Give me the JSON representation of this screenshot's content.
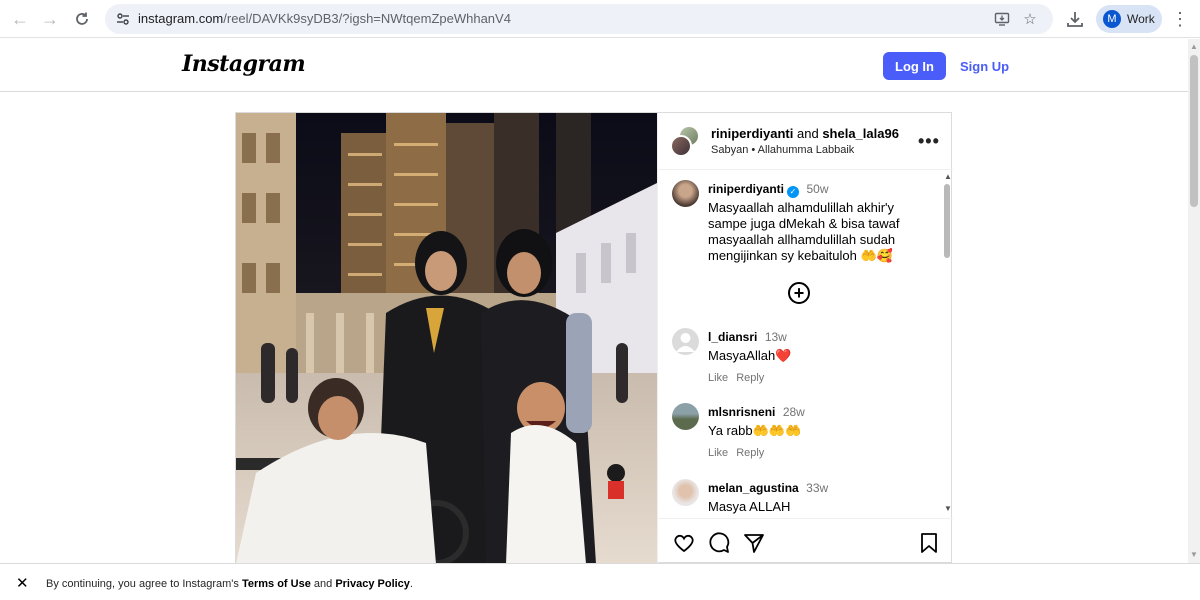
{
  "browser": {
    "url_host": "instagram.com",
    "url_path": "/reel/DAVKk9syDB3/?igsh=NWtqemZpeWhhanV4",
    "profile_initial": "M",
    "profile_label": "Work"
  },
  "header": {
    "logo": "Instagram",
    "login_label": "Log In",
    "signup_label": "Sign Up"
  },
  "post": {
    "user1": "riniperdiyanti",
    "and": "and",
    "user2": "shela_lala96",
    "audio": "Sabyan • Allahumma Labbaik",
    "more": "•••",
    "caption": {
      "user": "riniperdiyanti",
      "time": "50w",
      "text": "Masyaallah alhamdulillah akhir'y sampe juga dMekah & bisa tawaf masyaallah allhamdulillah sudah mengijinkan sy kebaituloh 🤲🥰"
    },
    "comments": [
      {
        "user": "l_diansri",
        "time": "13w",
        "text": "MasyaAllah❤️",
        "like": "Like",
        "reply": "Reply"
      },
      {
        "user": "mlsnrisneni",
        "time": "28w",
        "text": "Ya rabb🤲🤲🤲",
        "like": "Like",
        "reply": "Reply"
      },
      {
        "user": "melan_agustina",
        "time": "33w",
        "text": "Masya ALLAH"
      }
    ]
  },
  "cookie": {
    "prefix": "By continuing, you agree to Instagram's",
    "terms": "Terms of Use",
    "and": "and",
    "privacy": "Privacy Policy",
    "suffix": "."
  }
}
